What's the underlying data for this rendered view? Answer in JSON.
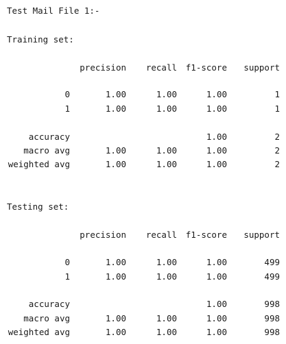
{
  "title": "Test Mail File 1:-",
  "sections": [
    {
      "heading": "Training set:",
      "headers": {
        "precision": "precision",
        "recall": "recall",
        "f1": "f1-score",
        "support": "support"
      },
      "rows": [
        {
          "label": "0",
          "precision": "1.00",
          "recall": "1.00",
          "f1": "1.00",
          "support": "1"
        },
        {
          "label": "1",
          "precision": "1.00",
          "recall": "1.00",
          "f1": "1.00",
          "support": "1"
        },
        {
          "label": "accuracy",
          "precision": "",
          "recall": "",
          "f1": "1.00",
          "support": "2"
        },
        {
          "label": "macro avg",
          "precision": "1.00",
          "recall": "1.00",
          "f1": "1.00",
          "support": "2"
        },
        {
          "label": "weighted avg",
          "precision": "1.00",
          "recall": "1.00",
          "f1": "1.00",
          "support": "2"
        }
      ]
    },
    {
      "heading": "Testing set:",
      "headers": {
        "precision": "precision",
        "recall": "recall",
        "f1": "f1-score",
        "support": "support"
      },
      "rows": [
        {
          "label": "0",
          "precision": "1.00",
          "recall": "1.00",
          "f1": "1.00",
          "support": "499"
        },
        {
          "label": "1",
          "precision": "1.00",
          "recall": "1.00",
          "f1": "1.00",
          "support": "499"
        },
        {
          "label": "accuracy",
          "precision": "",
          "recall": "",
          "f1": "1.00",
          "support": "998"
        },
        {
          "label": "macro avg",
          "precision": "1.00",
          "recall": "1.00",
          "f1": "1.00",
          "support": "998"
        },
        {
          "label": "weighted avg",
          "precision": "1.00",
          "recall": "1.00",
          "f1": "1.00",
          "support": "998"
        }
      ]
    }
  ]
}
